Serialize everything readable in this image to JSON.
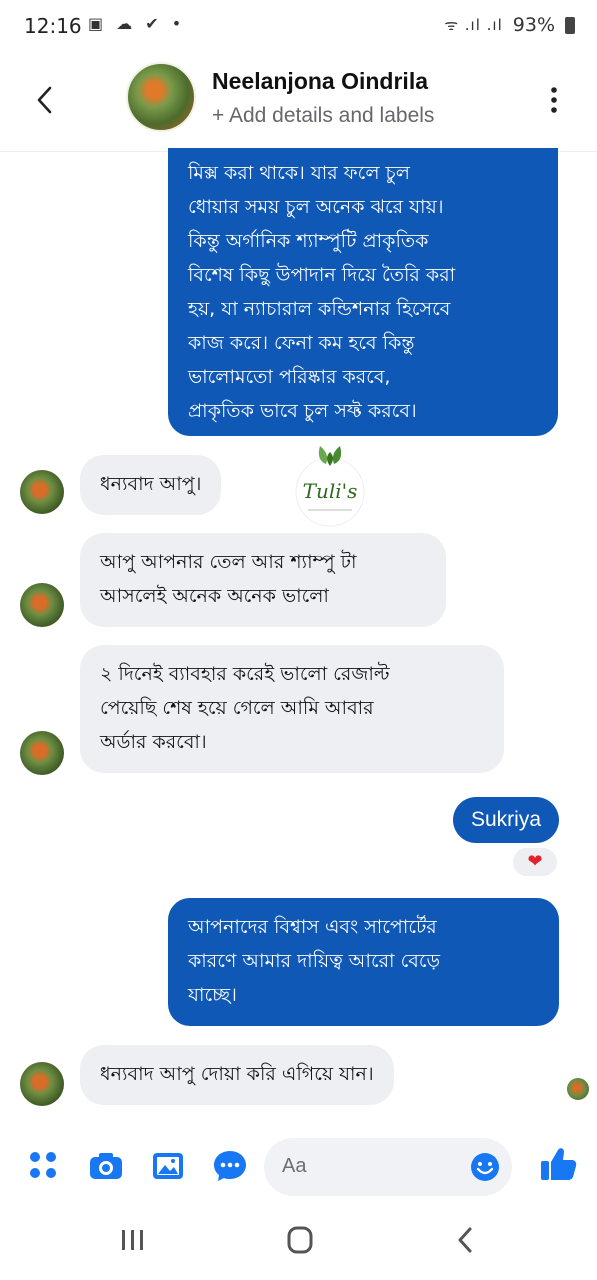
{
  "status_bar": {
    "time": "12:16",
    "left_icons": "▣ ☁ ✔ •",
    "signal": "ᯤ .ıl .ıl",
    "battery": "93%"
  },
  "header": {
    "contact_name": "Neelanjona Oindrila",
    "subtitle": "+ Add details and labels"
  },
  "messages": [
    {
      "dir": "out",
      "text": "মিক্স করা থাকে। যার ফলে চুল\nধোয়ার সময় চুল অনেক ঝরে যায়।\nকিন্তু অর্গানিক শ্যাম্পুটি প্রাকৃতিক\nবিশেষ কিছু উপাদান দিয়ে তৈরি করা\nহয়, যা ন্যাচারাল কন্ডিশনার হিসেবে\nকাজ করে। ফেনা কম হবে কিন্তু\nভালোমতো পরিষ্কার করবে,\nপ্রাকৃতিক ভাবে চুল সফ্ট করবে।"
    },
    {
      "dir": "in",
      "text": "ধন্যবাদ আপু।"
    },
    {
      "dir": "in",
      "text": "আপু আপনার তেল আর শ্যাম্পু টা\nআসলেই অনেক অনেক ভালো"
    },
    {
      "dir": "in",
      "text": "২ দিনেই ব্যাবহার করেই ভালো রেজাল্ট\nপেয়েছি শেষ হয়ে গেলে আমি আবার\nঅর্ডার করবো।"
    },
    {
      "dir": "out",
      "text": "Sukriya"
    },
    {
      "dir": "out",
      "text": "আপনাদের বিশ্বাস এবং সাপোর্টের\nকারণে আমার দায়িত্ব আরো বেড়ে\nযাচ্ছে।"
    },
    {
      "dir": "in",
      "text": "ধন্যবাদ আপু দোয়া করি এগিয়ে যান।"
    }
  ],
  "reaction": "❤",
  "watermark": {
    "brand": "Tuli's"
  },
  "composer": {
    "placeholder": "Aa"
  },
  "colors": {
    "accent": "#0f58b6",
    "incoming_bubble": "#eeeff2",
    "icon_blue": "#1877f2"
  },
  "icons": [
    "back-icon",
    "more-icon",
    "apps-icon",
    "camera-icon",
    "gallery-icon",
    "chat-icon",
    "emoji-icon",
    "like-icon",
    "recents-icon",
    "home-icon",
    "nav-back-icon"
  ]
}
